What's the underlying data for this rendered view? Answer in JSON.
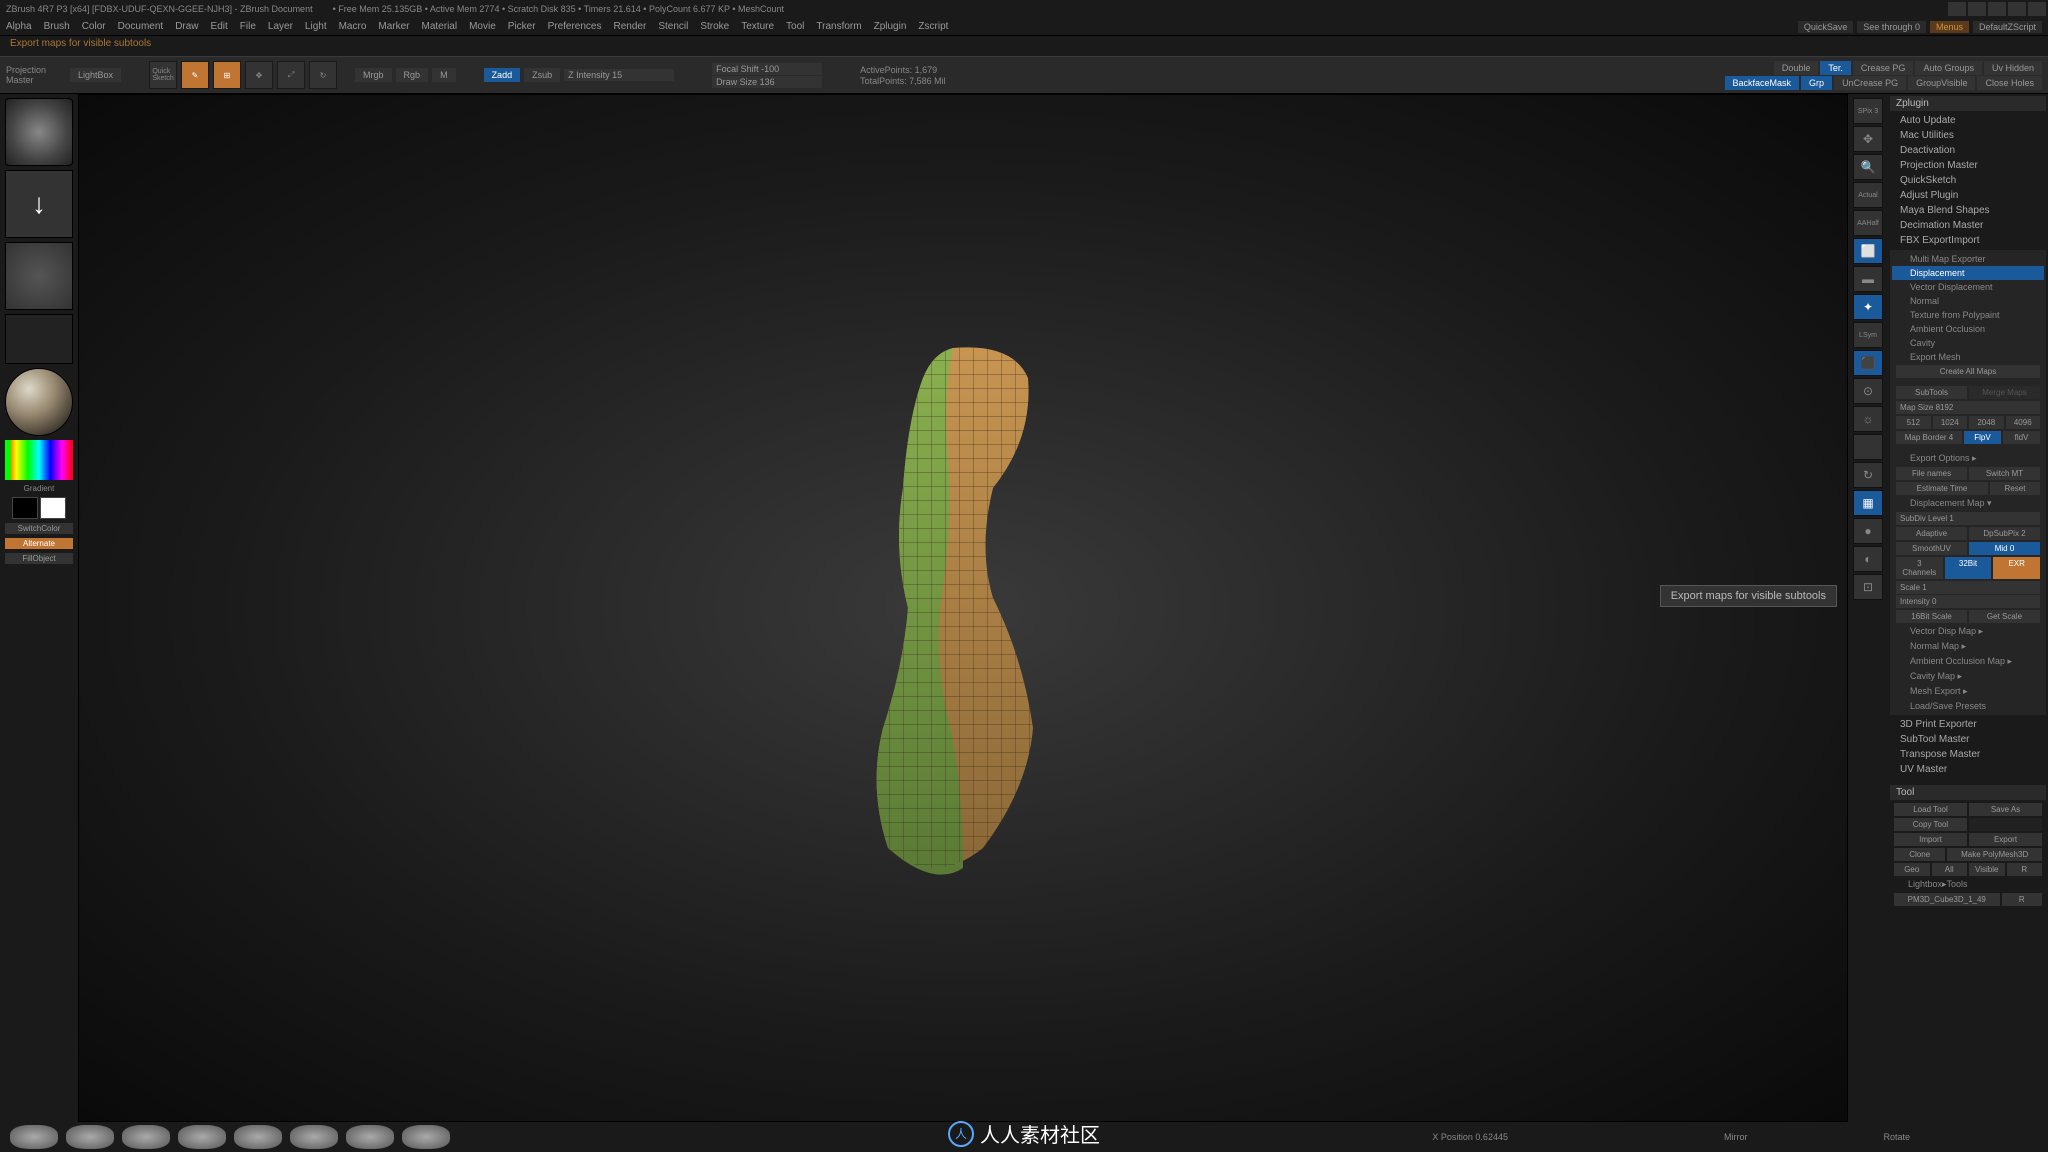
{
  "title": "ZBrush 4R7 P3 [x64] [FDBX-UDUF-QEXN-GGEE-NJH3] - ZBrush Document",
  "titlestats": "• Free Mem 25.135GB • Active Mem 2774 • Scratch Disk 835 • Timers 21.614 • PolyCount 6.677 KP • MeshCount",
  "menu": [
    "Alpha",
    "Brush",
    "Color",
    "Document",
    "Draw",
    "Edit",
    "File",
    "Layer",
    "Light",
    "Macro",
    "Marker",
    "Material",
    "Movie",
    "Picker",
    "Preferences",
    "Render",
    "Stencil",
    "Stroke",
    "Texture",
    "Tool",
    "Transform",
    "Zplugin",
    "Zscript"
  ],
  "topright": {
    "quicksave": "QuickSave",
    "seethrough": "See through  0",
    "menus": "Menus",
    "defscript": "DefaultZScript"
  },
  "status": "Export maps for visible subtools",
  "toolbar": {
    "projection": "Projection\nMaster",
    "lightbox": "LightBox",
    "quicksketch": "Quick\nSketch",
    "edit": "Edit",
    "draw": "Draw",
    "move": "Move",
    "scale": "Scale",
    "rotate": "Rotate",
    "mrgb": "Mrgb",
    "rgb": "Rgb",
    "m": "M",
    "zadd": "Zadd",
    "zsub": "Zsub",
    "zintensity": "Z Intensity 15",
    "focalshift": "Focal Shift -100",
    "drawsize": "Draw Size 136",
    "activepoints": "ActivePoints: 1,679",
    "totalpoints": "TotalPoints: 7,586 Mil",
    "double": "Double",
    "ter": "Ter.",
    "creasepg": "Crease PG",
    "autogroups": "Auto Groups",
    "unhidden": "Uv Hidden",
    "backface": "BackfaceMask",
    "grp": "Grp",
    "uncreasepg": "UnCrease PG",
    "groupvisible": "GroupVisible",
    "closeholes": "Close Holes"
  },
  "leftbar": {
    "gradient": "Gradient",
    "switchcolor": "SwitchColor",
    "alternate": "Alternate",
    "fillobject": "FillObject"
  },
  "tooltip": "Export maps for visible subtools",
  "righticons": [
    "SPix 3",
    "Scroll",
    "Zoom",
    "Actual",
    "AAHalf",
    "Persp",
    "Floor",
    "Local",
    "LSym",
    "Xpose",
    "",
    "Mem",
    "",
    "Rotate",
    "",
    "",
    "",
    "Spce"
  ],
  "panel": {
    "title": "Zplugin",
    "items": [
      "Auto Update",
      "",
      "Mac Utilities",
      "Deactivation",
      "Projection Master",
      "QuickSketch",
      "Adjust Plugin",
      "Maya Blend Shapes",
      "Decimation Master",
      "FBX ExportImport"
    ],
    "mme": {
      "title": "Multi Map Exporter",
      "displacement": "Displacement",
      "vectordisp": "Vector Displacement",
      "normal": "Normal",
      "texture": "Texture from Polypaint",
      "ao": "Ambient Occlusion",
      "cavity": "Cavity",
      "exportmesh": "Export Mesh",
      "createall": "Create All Maps",
      "subtools": "SubTools",
      "mergemaps": "Merge Maps",
      "mapsize": "Map Size 8192",
      "s512": "512",
      "s1024": "1024",
      "s2048": "2048",
      "s4096": "4096",
      "mapborder": "Map Border 4",
      "fluv": "FlpV",
      "fldv": "fldV",
      "exportopts": "Export Options  ▸",
      "filenames": "File names",
      "switchmt": "Switch MT",
      "esttime": "Estimate Time",
      "reset": "Reset",
      "dispmap": "Displacement Map  ▾",
      "subdivlevel": "SubDiv Level 1",
      "adaptive": "Adaptive",
      "dpsubpix": "DpSubPix 2",
      "smoothuv": "SmoothUV",
      "mid": "Mid 0",
      "channels": "3 Channels",
      "bit32": "32Bit",
      "exr": "EXR",
      "scale": "Scale 1",
      "intensity": "Intensity 0",
      "scale16": "16Bit Scale",
      "getscale": "Get Scale",
      "vdispmap": "Vector Disp Map  ▸",
      "normalmap": "Normal Map  ▸",
      "aomap": "Ambient Occlusion Map  ▸",
      "cavitymap": "Cavity Map  ▸",
      "meshexport": "Mesh Export  ▸",
      "loadsave": "Load/Save Presets"
    },
    "items2": [
      "3D Print Exporter",
      "SubTool Master",
      "Transpose Master",
      "UV Master"
    ],
    "tool": {
      "title": "Tool",
      "loadtool": "Load Tool",
      "saveas": "Save As",
      "copytool": "Copy Tool",
      "import": "Import",
      "export": "Export",
      "clone": "Clone",
      "makepoly": "Make PolyMesh3D",
      "geo": "Geo",
      "all": "All",
      "visible": "Visible",
      "r": "R",
      "lightbox": "Lightbox▸Tools",
      "cube": "PM3D_Cube3D_1_49",
      "r2": "R"
    }
  },
  "bottom": {
    "xpos": "X Position  0.62445",
    "mirror": "Mirror",
    "rotate": "Rotate"
  }
}
